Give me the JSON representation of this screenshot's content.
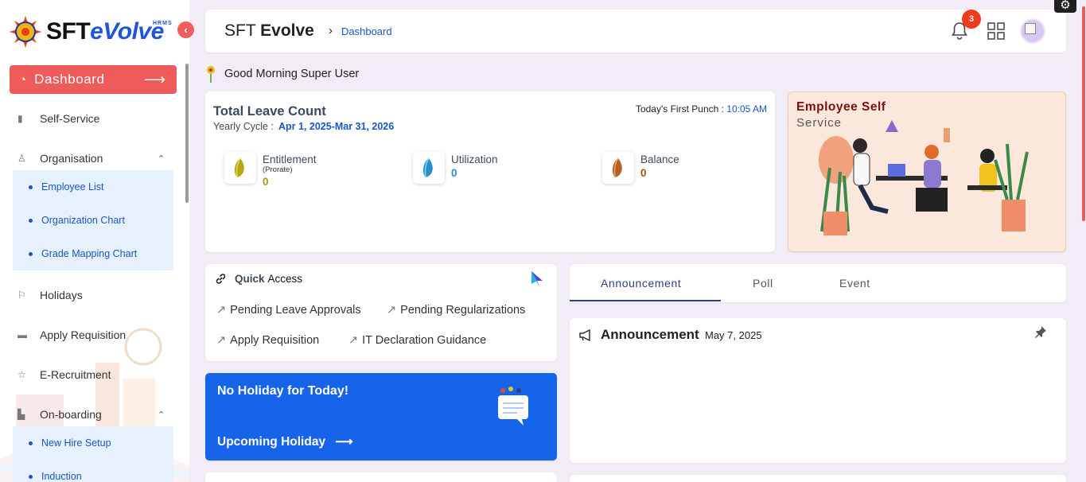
{
  "brand": {
    "name_a": "SFT",
    "name_b": "eVolve",
    "sub": "HRMS"
  },
  "sidebar": {
    "dashboard_label": "Dashboard",
    "items": [
      {
        "label": "Self-Service"
      },
      {
        "label": "Organisation"
      },
      {
        "label": "Holidays"
      },
      {
        "label": "Apply Requisition"
      },
      {
        "label": "E-Recruitment"
      },
      {
        "label": "On-boarding"
      }
    ],
    "org_sub": [
      "Employee List",
      "Organization Chart",
      "Grade Mapping Chart"
    ],
    "onboarding_sub": [
      "New Hire Setup",
      "Induction"
    ]
  },
  "header": {
    "title_a": "SFT",
    "title_b": "Evolve",
    "breadcrumb": "Dashboard",
    "notification_count": "3"
  },
  "greeting": "Good Morning Super User",
  "leave": {
    "title": "Total Leave Count",
    "cycle_label": "Yearly Cycle :",
    "cycle_value": "Apr 1, 2025-Mar 31, 2026",
    "punch_label": "Today's First Punch :",
    "punch_time": "10:05 AM",
    "stats": [
      {
        "name": "Entitlement",
        "sub": "(Prorate)",
        "value": "0",
        "color": "#a89b12"
      },
      {
        "name": "Utilization",
        "sub": "",
        "value": "0",
        "color": "#2b8fc7"
      },
      {
        "name": "Balance",
        "sub": "",
        "value": "0",
        "color": "#a0521c"
      }
    ]
  },
  "ess": {
    "line1": "Employee Self",
    "line2": "Service"
  },
  "quick_access": {
    "label_a": "Quick",
    "label_b": "Access",
    "links": [
      "Pending Leave Approvals",
      "Pending Regularizations",
      "Apply Requisition",
      "IT Declaration Guidance"
    ]
  },
  "holiday": {
    "title": "No Holiday for Today!",
    "upcoming": "Upcoming Holiday"
  },
  "tabs": [
    "Announcement",
    "Poll",
    "Event"
  ],
  "announcement": {
    "title": "Announcement",
    "date": "May 7, 2025"
  },
  "colors": {
    "accent_red": "#ef5b5b",
    "link_blue": "#1a56c8",
    "holiday_blue": "#1564ea",
    "tab_active": "#2f3e8a"
  }
}
